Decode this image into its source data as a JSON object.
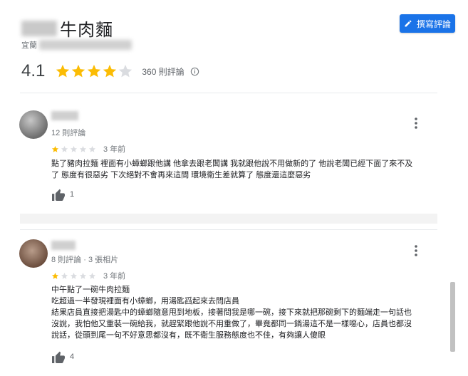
{
  "place": {
    "title": "牛肉麵",
    "address_prefix": "宜蘭",
    "rating": "4.1",
    "rating_value": 4.1,
    "total_reviews": "360 則評論"
  },
  "toolbar": {
    "write_review_label": "撰寫評論"
  },
  "reviews": [
    {
      "reviewer_meta": "12 則評論",
      "stars": 1,
      "date": "3 年前",
      "lines": [
        "點了豬肉拉麵 裡面有小蟑螂跟他講 他拿去跟老闆講 我就跟他說不用做新的了 他說老闆已經下面了來不及",
        "了 態度有很惡劣 下次絕對不會再來這間 環境衛生差就算了 態度還這麼惡劣"
      ],
      "likes": "1"
    },
    {
      "reviewer_meta": "8 則評論 · 3 張相片",
      "stars": 1,
      "date": "3 年前",
      "lines": [
        "中午點了一碗牛肉拉麵",
        "吃超過一半發現裡面有小蟑螂，用湯匙舀起來去問店員",
        "結果店員直接把湯匙中的蟑螂隨意甩到地板，接著問我是哪一碗，接下來就把那碗剩下的麵端走一句話也",
        "沒說，我怕他又重裝一碗給我，就趕緊跟他說不用重做了，畢竟都同一鍋湯這不是一樣噁心，店員也都沒",
        "說話，從頭到尾一句不好意思都沒有，既不衛生服務態度也不佳，有夠讓人傻眼"
      ],
      "likes": "4"
    }
  ],
  "colors": {
    "accent": "#1a73e8",
    "star_filled": "#fbbc04",
    "star_empty": "#dadce0"
  },
  "icons": [
    "pencil-icon",
    "star-icon",
    "info-icon",
    "more-vert-icon",
    "thumb-up-icon"
  ]
}
